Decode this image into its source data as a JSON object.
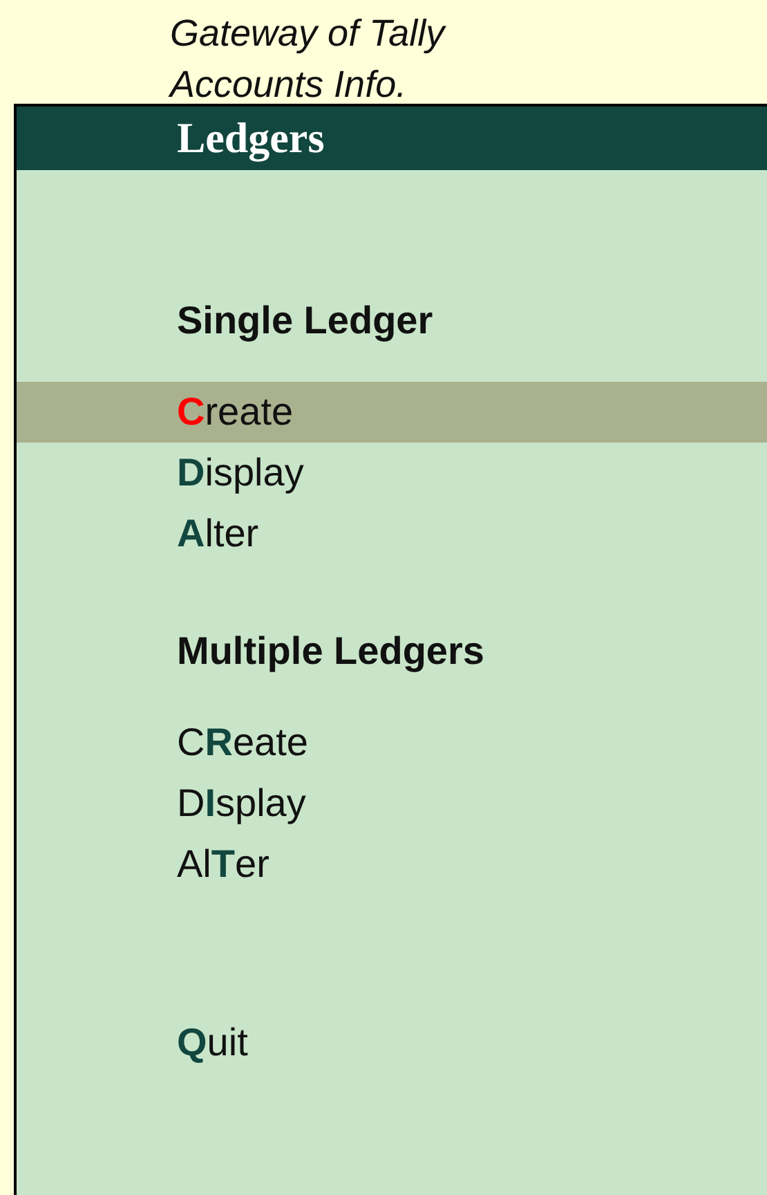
{
  "breadcrumb": [
    "Gateway of Tally",
    "Accounts Info."
  ],
  "panel": {
    "title": "Ledgers",
    "sections": [
      {
        "heading": "Single Ledger",
        "items": [
          {
            "label": "**C**reate",
            "selected": true
          },
          {
            "label": "**D**isplay",
            "selected": false
          },
          {
            "label": "**A**lter",
            "selected": false
          }
        ]
      },
      {
        "heading": "Multiple Ledgers",
        "items": [
          {
            "label": "C**R**eate",
            "selected": false
          },
          {
            "label": "D**I**splay",
            "selected": false
          },
          {
            "label": "Al**T**er",
            "selected": false
          }
        ]
      }
    ],
    "quit": {
      "label": "**Q**uit",
      "selected": false
    }
  }
}
